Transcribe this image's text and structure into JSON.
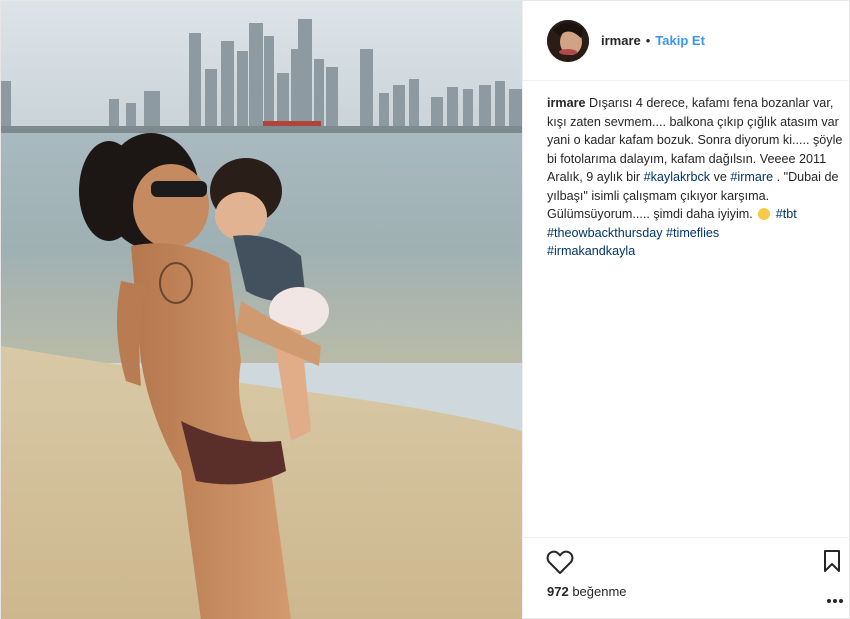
{
  "post": {
    "username": "irmare",
    "separator": "•",
    "follow_label": "Takip Et",
    "caption": {
      "user": "irmare",
      "text_1": " Dışarısı 4 derece, kafamı fena bozanlar var, kışı zaten sevmem.... balkona çıkıp çığlık atasım var yani o kadar kafam bozuk. Sonra diyorum ki..... şöyle bi fotolarıma dalayım, kafam dağılsın. Veeee 2011 Aralık, 9 aylık bir ",
      "tag_1": "#kaylakrbck",
      "text_2": " ve ",
      "tag_2": "#irmare",
      "text_3": " . \"Dubai de yılbaşı\" isimli çalışmam çıkıyor karşıma. Gülümsüyorum..... şimdi daha iyiyim. ",
      "tag_3": "#tbt",
      "tag_4": "#theowbackthursday",
      "tag_5": "#timeflies",
      "tag_6": "#irmakandkayla"
    },
    "likes_count": "972",
    "likes_label": " beğenme"
  },
  "icons": {
    "like": "heart-icon",
    "save": "bookmark-icon",
    "more": "more-options-icon"
  },
  "colors": {
    "link_blue": "#3897f0",
    "hashtag": "#003569",
    "text": "#262626",
    "divider": "#efefef"
  }
}
